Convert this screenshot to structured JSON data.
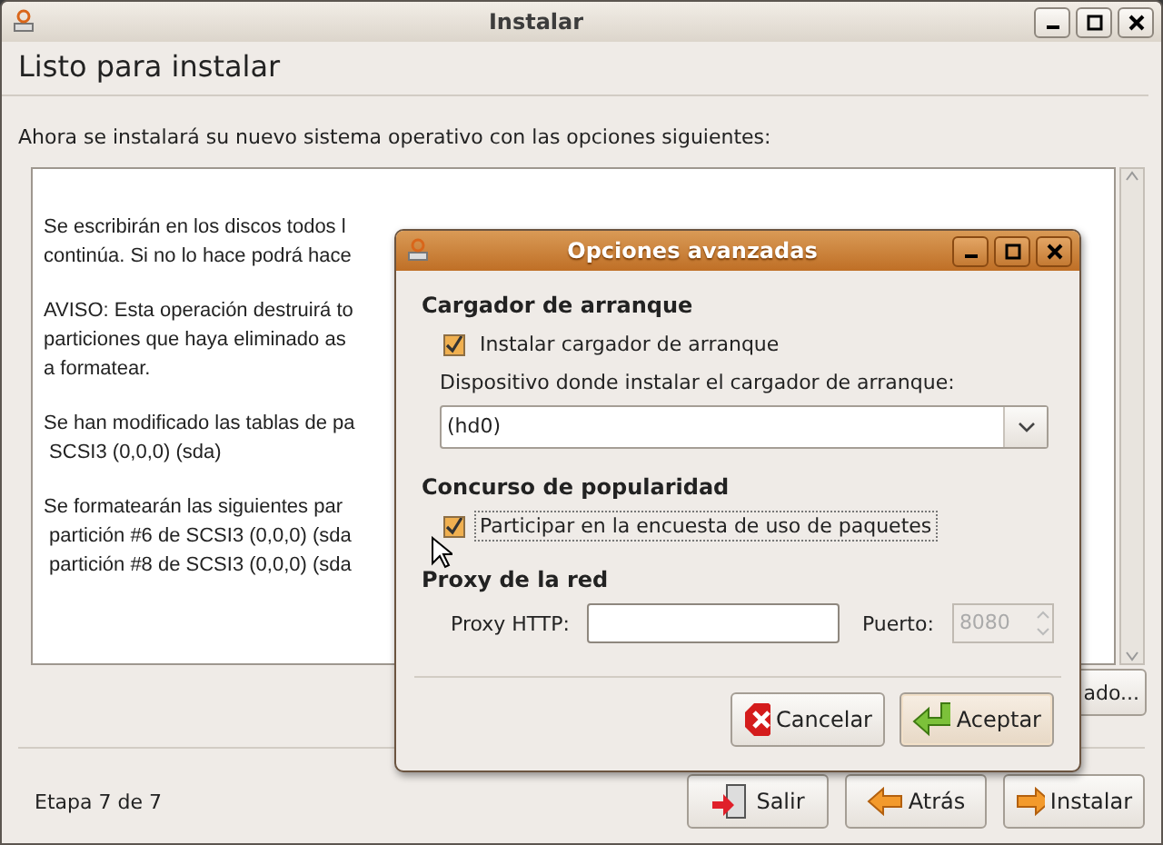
{
  "window": {
    "title": "Instalar"
  },
  "heading": "Listo para instalar",
  "intro": "Ahora se instalará su nuevo sistema operativo con las opciones siguientes:",
  "summary": [
    [
      "Se escribirán en los discos todos l",
      "continúa. Si no lo hace podrá hace"
    ],
    [
      "AVISO: Esta operación destruirá to",
      "particiones que haya eliminado as",
      "a formatear."
    ],
    [
      "Se han modificado las tablas de pa",
      " SCSI3 (0,0,0) (sda)"
    ],
    [
      "Se formatearán las siguientes par",
      " partición #6 de SCSI3 (0,0,0) (sda",
      " partición #8 de SCSI3 (0,0,0) (sda"
    ]
  ],
  "advanced_button": "ado...",
  "step": "Etapa 7 de 7",
  "buttons": [
    {
      "label": "Salir",
      "kind": "quit"
    },
    {
      "label": "Atrás",
      "kind": "back"
    },
    {
      "label": "Instalar",
      "kind": "forward"
    }
  ],
  "dialog": {
    "title": "Opciones avanzadas",
    "bootloader": {
      "heading": "Cargador de arranque",
      "checkbox": {
        "label": "Instalar cargador de arranque",
        "checked": true,
        "focused": false
      },
      "device_label": "Dispositivo donde instalar el cargador de arranque:",
      "device": "(hd0)"
    },
    "popcon": {
      "heading": "Concurso de popularidad",
      "checkbox": {
        "label": "Participar en la encuesta de uso de paquetes",
        "checked": true,
        "focused": true
      }
    },
    "proxy": {
      "heading": "Proxy de la red",
      "http_label": "Proxy HTTP:",
      "port_label": "Puerto:",
      "port": "8080",
      "port_disabled": true
    },
    "buttons": [
      {
        "label": "Cancelar",
        "kind": "cancel",
        "default": false
      },
      {
        "label": "Aceptar",
        "kind": "ok",
        "default": true
      }
    ]
  }
}
